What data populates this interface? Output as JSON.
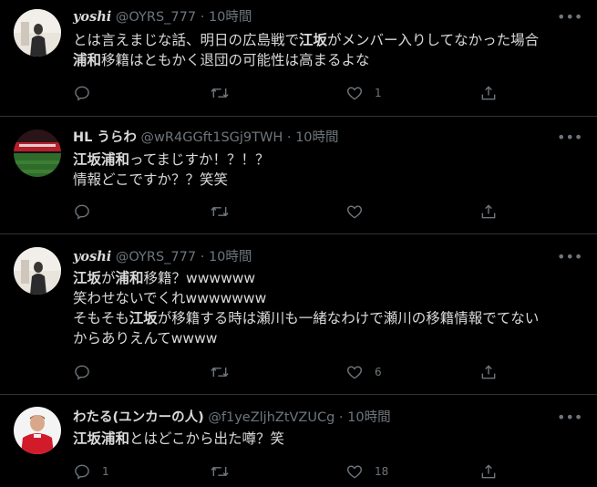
{
  "tweets": [
    {
      "name": "yoshi",
      "handle": "@OYRS_777",
      "dot": "·",
      "time": "10時間",
      "lines": [
        [
          {
            "t": "とは言えまじな話、明日の広島戦で",
            "b": false
          },
          {
            "t": "江坂",
            "b": true
          },
          {
            "t": "がメンバー入りしてなかった場合",
            "b": false
          }
        ],
        [
          {
            "t": "浦和",
            "b": true
          },
          {
            "t": "移籍はともかく退団の可能性は高まるよな",
            "b": false
          }
        ]
      ],
      "replies": "",
      "retweets": "",
      "likes": "1"
    },
    {
      "name": "HL うらわ",
      "handle": "@wR4GGft1SGj9TWH",
      "dot": "·",
      "time": "10時間",
      "lines": [
        [
          {
            "t": "江坂浦和",
            "b": true
          },
          {
            "t": "ってまじすか！？！？",
            "b": false
          }
        ],
        [
          {
            "t": "情報どこですか？？笑笑",
            "b": false
          }
        ]
      ],
      "replies": "",
      "retweets": "",
      "likes": ""
    },
    {
      "name": "yoshi",
      "handle": "@OYRS_777",
      "dot": "·",
      "time": "10時間",
      "lines": [
        [
          {
            "t": "江坂",
            "b": true
          },
          {
            "t": "が",
            "b": false
          },
          {
            "t": "浦和",
            "b": true
          },
          {
            "t": "移籍？wwwwww",
            "b": false
          }
        ],
        [
          {
            "t": "笑わせないでくれwwwwwww",
            "b": false
          }
        ],
        [
          {
            "t": "そもそも",
            "b": false
          },
          {
            "t": "江坂",
            "b": true
          },
          {
            "t": "が移籍する時は瀬川も一緒なわけで瀬川の移籍情報でてない",
            "b": false
          }
        ],
        [
          {
            "t": "からありえんてwwww",
            "b": false
          }
        ]
      ],
      "replies": "",
      "retweets": "",
      "likes": "6"
    },
    {
      "name": "わたる(ユンカーの人)",
      "handle": "@f1yeZljhZtVZUCg",
      "dot": "·",
      "time": "10時間",
      "lines": [
        [
          {
            "t": "江坂浦和",
            "b": true
          },
          {
            "t": "とはどこから出た噂？笑",
            "b": false
          }
        ]
      ],
      "replies": "1",
      "retweets": "",
      "likes": "18"
    }
  ],
  "more_glyph": "•••",
  "icons": [
    "reply-icon",
    "retweet-icon",
    "like-icon",
    "share-icon",
    "more-icon"
  ],
  "colors": {
    "background": "#000000",
    "text": "#d9d9d9",
    "muted": "#6e767d",
    "divider": "#2f3336"
  }
}
